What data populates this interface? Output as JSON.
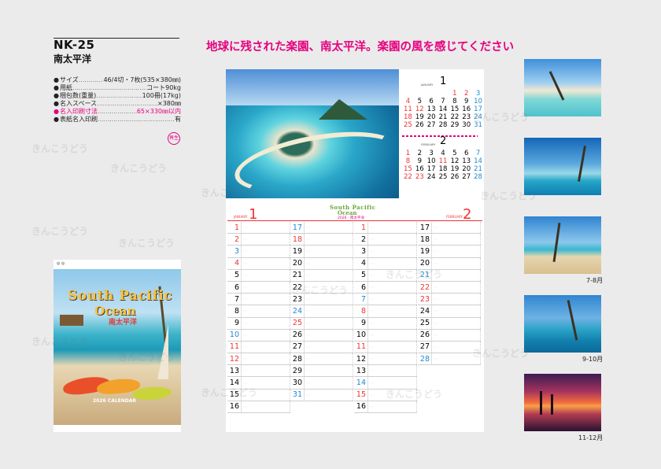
{
  "product": {
    "code": "NK-25",
    "name": "南太平洋"
  },
  "specs": [
    {
      "label": "サイズ",
      "value": "46/4切・7枚(535×380㎜)",
      "pink": false
    },
    {
      "label": "用紙",
      "value": "コート90kg",
      "pink": false
    },
    {
      "label": "梱包数(重量)",
      "value": "100冊(17kg)",
      "pink": false
    },
    {
      "label": "名入スペース",
      "value": "×380㎜",
      "pink": false
    },
    {
      "label": "名入印刷寸法",
      "value": "65×330㎜以内",
      "pink": true
    },
    {
      "label": "表紙名入印刷",
      "value": "有",
      "pink": false
    }
  ],
  "stamp": "再生",
  "headline": "地球に残された楽園、南太平洋。楽園の風を感じてください",
  "cover": {
    "title_line1": "South Pacific",
    "title_line2": "Ocean",
    "title_jp": "南太平洋",
    "subtitle": "2026 CALENDAR"
  },
  "calendar": {
    "mini_months": [
      {
        "number": "1",
        "name": "JANUARY",
        "weeks": [
          [
            {
              "t": ""
            },
            {
              "t": ""
            },
            {
              "t": ""
            },
            {
              "t": ""
            },
            {
              "t": "1",
              "c": "red"
            },
            {
              "t": "2",
              "c": "red"
            },
            {
              "t": "3",
              "c": "blue"
            }
          ],
          [
            {
              "t": "4",
              "c": "red"
            },
            {
              "t": "5"
            },
            {
              "t": "6"
            },
            {
              "t": "7"
            },
            {
              "t": "8"
            },
            {
              "t": "9"
            },
            {
              "t": "10",
              "c": "blue"
            }
          ],
          [
            {
              "t": "11",
              "c": "red"
            },
            {
              "t": "12",
              "c": "red"
            },
            {
              "t": "13"
            },
            {
              "t": "14"
            },
            {
              "t": "15"
            },
            {
              "t": "16"
            },
            {
              "t": "17",
              "c": "blue"
            }
          ],
          [
            {
              "t": "18",
              "c": "red"
            },
            {
              "t": "19"
            },
            {
              "t": "20"
            },
            {
              "t": "21"
            },
            {
              "t": "22"
            },
            {
              "t": "23"
            },
            {
              "t": "24",
              "c": "blue"
            }
          ],
          [
            {
              "t": "25",
              "c": "red"
            },
            {
              "t": "26"
            },
            {
              "t": "27"
            },
            {
              "t": "28"
            },
            {
              "t": "29"
            },
            {
              "t": "30"
            },
            {
              "t": "31",
              "c": "blue"
            }
          ]
        ]
      },
      {
        "number": "2",
        "name": "FEBRUARY",
        "weeks": [
          [
            {
              "t": "1",
              "c": "red"
            },
            {
              "t": "2"
            },
            {
              "t": "3"
            },
            {
              "t": "4"
            },
            {
              "t": "5"
            },
            {
              "t": "6"
            },
            {
              "t": "7",
              "c": "blue"
            }
          ],
          [
            {
              "t": "8",
              "c": "red"
            },
            {
              "t": "9"
            },
            {
              "t": "10"
            },
            {
              "t": "11",
              "c": "red"
            },
            {
              "t": "12"
            },
            {
              "t": "13"
            },
            {
              "t": "14",
              "c": "blue"
            }
          ],
          [
            {
              "t": "15",
              "c": "red"
            },
            {
              "t": "16"
            },
            {
              "t": "17"
            },
            {
              "t": "18"
            },
            {
              "t": "19"
            },
            {
              "t": "20"
            },
            {
              "t": "21",
              "c": "blue"
            }
          ],
          [
            {
              "t": "22",
              "c": "red"
            },
            {
              "t": "23",
              "c": "red"
            },
            {
              "t": "24"
            },
            {
              "t": "25"
            },
            {
              "t": "26"
            },
            {
              "t": "27"
            },
            {
              "t": "28",
              "c": "blue"
            }
          ]
        ]
      }
    ],
    "brand_line1": "South Pacific",
    "brand_line2": "Ocean",
    "brand_sub": "2026 - 南太平洋",
    "month1_number": "1",
    "month1_name": "JANUARY",
    "month2_number": "2",
    "month2_name": "FEBRUARY",
    "columns": [
      [
        {
          "d": "1",
          "c": "red"
        },
        {
          "d": "2",
          "c": "red"
        },
        {
          "d": "3",
          "c": "blue"
        },
        {
          "d": "4",
          "c": "red"
        },
        {
          "d": "5"
        },
        {
          "d": "6"
        },
        {
          "d": "7"
        },
        {
          "d": "8"
        },
        {
          "d": "9"
        },
        {
          "d": "10",
          "c": "blue"
        },
        {
          "d": "11",
          "c": "red"
        },
        {
          "d": "12",
          "c": "red"
        },
        {
          "d": "13"
        },
        {
          "d": "14"
        },
        {
          "d": "15"
        },
        {
          "d": "16"
        }
      ],
      [
        {
          "d": "17",
          "c": "blue"
        },
        {
          "d": "18",
          "c": "red"
        },
        {
          "d": "19"
        },
        {
          "d": "20"
        },
        {
          "d": "21"
        },
        {
          "d": "22"
        },
        {
          "d": "23"
        },
        {
          "d": "24",
          "c": "blue"
        },
        {
          "d": "25",
          "c": "red"
        },
        {
          "d": "26"
        },
        {
          "d": "27"
        },
        {
          "d": "28"
        },
        {
          "d": "29"
        },
        {
          "d": "30"
        },
        {
          "d": "31",
          "c": "blue"
        }
      ],
      [
        {
          "d": "1",
          "c": "red"
        },
        {
          "d": "2"
        },
        {
          "d": "3"
        },
        {
          "d": "4"
        },
        {
          "d": "5"
        },
        {
          "d": "6"
        },
        {
          "d": "7",
          "c": "blue"
        },
        {
          "d": "8",
          "c": "red"
        },
        {
          "d": "9"
        },
        {
          "d": "10"
        },
        {
          "d": "11",
          "c": "red"
        },
        {
          "d": "12"
        },
        {
          "d": "13"
        },
        {
          "d": "14",
          "c": "blue"
        },
        {
          "d": "15",
          "c": "red"
        },
        {
          "d": "16"
        }
      ],
      [
        {
          "d": "17"
        },
        {
          "d": "18"
        },
        {
          "d": "19"
        },
        {
          "d": "20"
        },
        {
          "d": "21",
          "c": "blue"
        },
        {
          "d": "22",
          "c": "red"
        },
        {
          "d": "23",
          "c": "red"
        },
        {
          "d": "24"
        },
        {
          "d": "25"
        },
        {
          "d": "26"
        },
        {
          "d": "27"
        },
        {
          "d": "28",
          "c": "blue"
        }
      ]
    ]
  },
  "thumbnails": [
    {
      "label": ""
    },
    {
      "label": ""
    },
    {
      "label": "7-8月"
    },
    {
      "label": "9-10月"
    },
    {
      "label": "11-12月"
    }
  ],
  "watermark": "きんこうどう",
  "colors": {
    "accent": "#e6007e",
    "holiday": "#e33333",
    "saturday": "#1b8bd1",
    "background": "#ebebeb"
  }
}
